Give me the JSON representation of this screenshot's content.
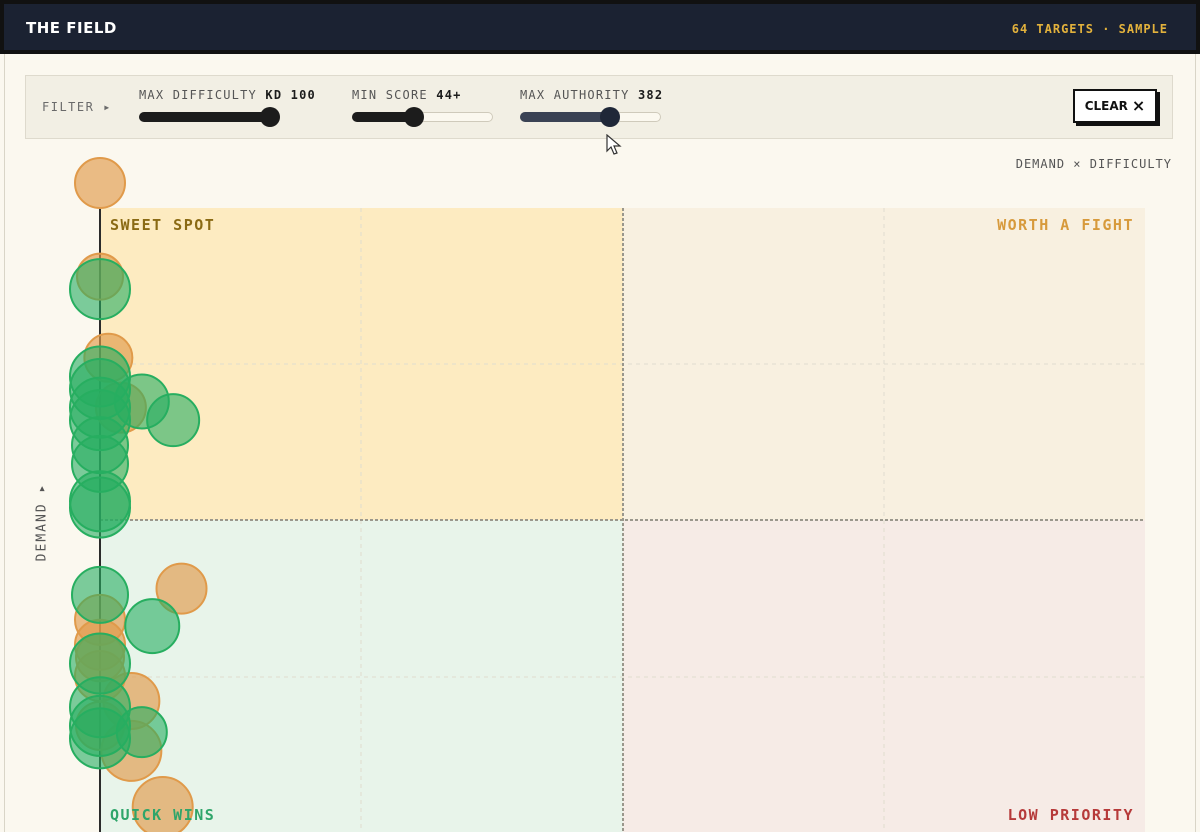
{
  "header": {
    "brand": "THE FIELD",
    "status": "64 TARGETS · SAMPLE"
  },
  "filters": {
    "label": "FILTER ▸",
    "sliders": [
      {
        "label": "MAX DIFFICULTY",
        "value_text": "KD 100",
        "fraction": 0.93
      },
      {
        "label": "MIN SCORE",
        "value_text": "44+",
        "fraction": 0.44
      },
      {
        "label": "MAX AUTHORITY",
        "value_text": "382",
        "fraction": 0.64
      }
    ],
    "clear_label": "CLEAR",
    "clear_icon": "×"
  },
  "chart_caption": "DEMAND × DIFFICULTY",
  "y_axis_label": "DEMAND ▸",
  "colors": {
    "sweet_spot_fill": "#fdebc1",
    "worth_fight_fill": "#f8f0e0",
    "quick_wins_fill": "#e8f4ea",
    "low_priority_fill": "#f6ebe6",
    "sweet_spot_text": "#8a6a14",
    "worth_fight_text": "#d79a3c",
    "quick_wins_text": "#2fa56a",
    "low_priority_text": "#b63a3a",
    "orange_point": "#e09a4a",
    "green_point": "#27ae60"
  },
  "chart_data": {
    "type": "scatter",
    "xlabel": "",
    "ylabel": "DEMAND",
    "xlim": [
      0,
      100
    ],
    "ylim": [
      0,
      100
    ],
    "quadrants": {
      "top_left": "SWEET SPOT",
      "top_right": "WORTH A FIGHT",
      "bottom_left": "QUICK WINS",
      "bottom_right": "LOW PRIORITY"
    },
    "series": [
      {
        "color": "orange",
        "points": [
          {
            "x": 0,
            "y": 104,
            "r": 25
          },
          {
            "x": 0,
            "y": 89,
            "r": 23
          },
          {
            "x": 0.8,
            "y": 76,
            "r": 24
          },
          {
            "x": 2,
            "y": 68,
            "r": 25
          },
          {
            "x": 7.8,
            "y": 39,
            "r": 25
          },
          {
            "x": 0,
            "y": 34,
            "r": 25
          },
          {
            "x": 0,
            "y": 30,
            "r": 25
          },
          {
            "x": 0,
            "y": 28,
            "r": 24
          },
          {
            "x": 0,
            "y": 25,
            "r": 25
          },
          {
            "x": 3,
            "y": 21,
            "r": 28
          },
          {
            "x": 0,
            "y": 17,
            "r": 24
          },
          {
            "x": 3,
            "y": 13,
            "r": 30
          },
          {
            "x": 6,
            "y": 4,
            "r": 30
          }
        ]
      },
      {
        "color": "green",
        "points": [
          {
            "x": 0,
            "y": 87,
            "r": 30
          },
          {
            "x": 0,
            "y": 73,
            "r": 30
          },
          {
            "x": 0,
            "y": 71,
            "r": 30
          },
          {
            "x": 0,
            "y": 68,
            "r": 30
          },
          {
            "x": 0,
            "y": 66,
            "r": 30
          },
          {
            "x": 4,
            "y": 69,
            "r": 27
          },
          {
            "x": 7,
            "y": 66,
            "r": 26
          },
          {
            "x": 0,
            "y": 62,
            "r": 28
          },
          {
            "x": 0,
            "y": 59,
            "r": 28
          },
          {
            "x": 0,
            "y": 53,
            "r": 30
          },
          {
            "x": 0,
            "y": 52,
            "r": 30
          },
          {
            "x": 0,
            "y": 38,
            "r": 28
          },
          {
            "x": 5,
            "y": 33,
            "r": 27
          },
          {
            "x": 0,
            "y": 27,
            "r": 30
          },
          {
            "x": 4,
            "y": 16,
            "r": 25
          },
          {
            "x": 0,
            "y": 17,
            "r": 30
          },
          {
            "x": 0,
            "y": 15,
            "r": 30
          },
          {
            "x": 0,
            "y": 20,
            "r": 30
          }
        ]
      }
    ]
  }
}
